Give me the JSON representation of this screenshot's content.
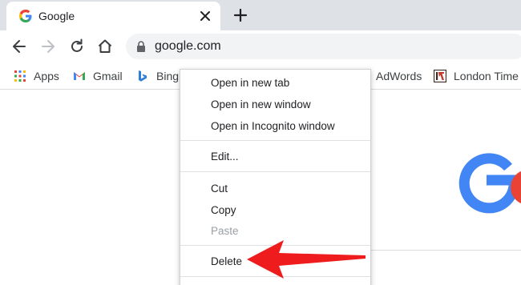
{
  "tab": {
    "title": "Google",
    "favicon": "google-g-icon",
    "close": "close-icon"
  },
  "new_tab": {
    "icon": "plus-icon"
  },
  "toolbar": {
    "back": "arrow-left-icon",
    "forward": "arrow-right-icon",
    "reload": "reload-icon",
    "home": "home-icon",
    "url": "google.com",
    "lock": "lock-icon"
  },
  "bookmarks": [
    {
      "label": "Apps",
      "icon": "apps-grid-icon"
    },
    {
      "label": "Gmail",
      "icon": "gmail-icon"
    },
    {
      "label": "Bing",
      "icon": "bing-icon"
    },
    {
      "label": "AdWords",
      "icon": ""
    },
    {
      "label": "London Time",
      "icon": "london-time-icon"
    }
  ],
  "context_menu": {
    "items": [
      {
        "label": "Open in new tab",
        "enabled": true
      },
      {
        "label": "Open in new window",
        "enabled": true
      },
      {
        "label": "Open in Incognito window",
        "enabled": true
      },
      {
        "label": "Edit...",
        "enabled": true
      },
      {
        "label": "Cut",
        "enabled": true
      },
      {
        "label": "Copy",
        "enabled": true
      },
      {
        "label": "Paste",
        "enabled": false
      },
      {
        "label": "Delete",
        "enabled": true
      }
    ]
  },
  "colors": {
    "google_blue": "#4285f4",
    "google_red": "#ea4335",
    "arrow_red": "#ee1c1c",
    "tabstrip": "#dee1e6"
  }
}
